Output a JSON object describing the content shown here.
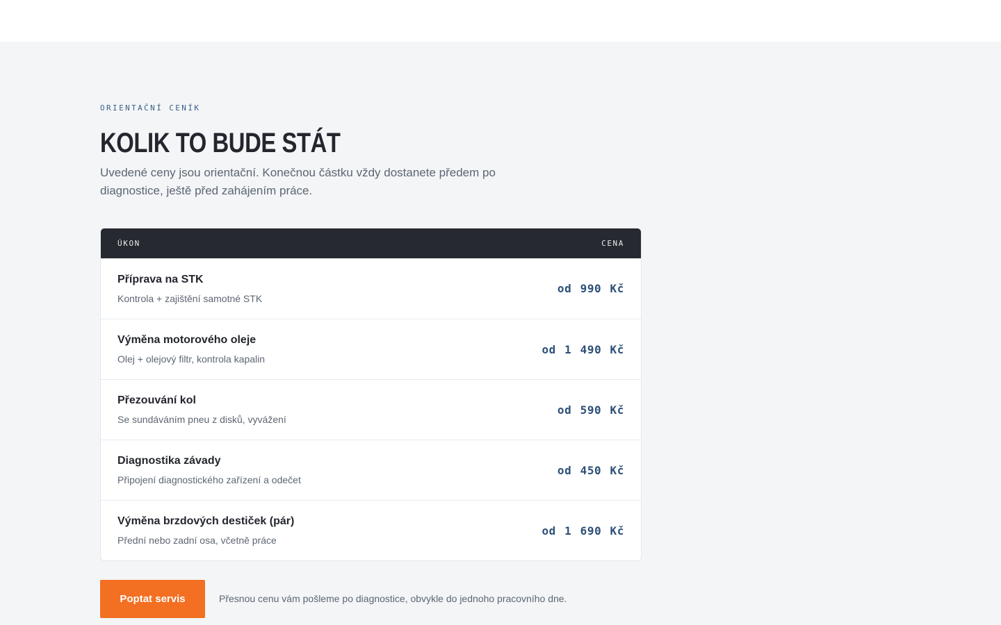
{
  "pricing": {
    "eyebrow": "ORIENTAČNÍ CENÍK",
    "title": "KOLIK TO BUDE STÁT",
    "subtitle": "Uvedené ceny jsou orientační. Konečnou částku vždy dostanete předem po diagnostice, ještě před zahájením práce.",
    "table": {
      "col_service": "ÚKON",
      "col_price": "CENA",
      "rows": [
        {
          "name": "Příprava na STK",
          "desc": "Kontrola + zajištění samotné STK",
          "price": "od 990 Kč"
        },
        {
          "name": "Výměna motorového oleje",
          "desc": "Olej + olejový filtr, kontrola kapalin",
          "price": "od 1 490 Kč"
        },
        {
          "name": "Přezouvání kol",
          "desc": "Se sundáváním pneu z disků, vyvážení",
          "price": "od 590 Kč"
        },
        {
          "name": "Diagnostika závady",
          "desc": "Připojení diagnostického zařízení a odečet",
          "price": "od 450 Kč"
        },
        {
          "name": "Výměna brzdových destiček (pár)",
          "desc": "Přední nebo zadní osa, včetně práce",
          "price": "od 1 690 Kč"
        }
      ]
    },
    "cta_label": "Poptat servis",
    "cta_note": "Přesnou cenu vám pošleme po diagnostice, obvykle do jednoho pracovního dne."
  },
  "colors": {
    "accent": "#f36f21",
    "price": "#2c4f78",
    "header_dark": "#26292f"
  }
}
